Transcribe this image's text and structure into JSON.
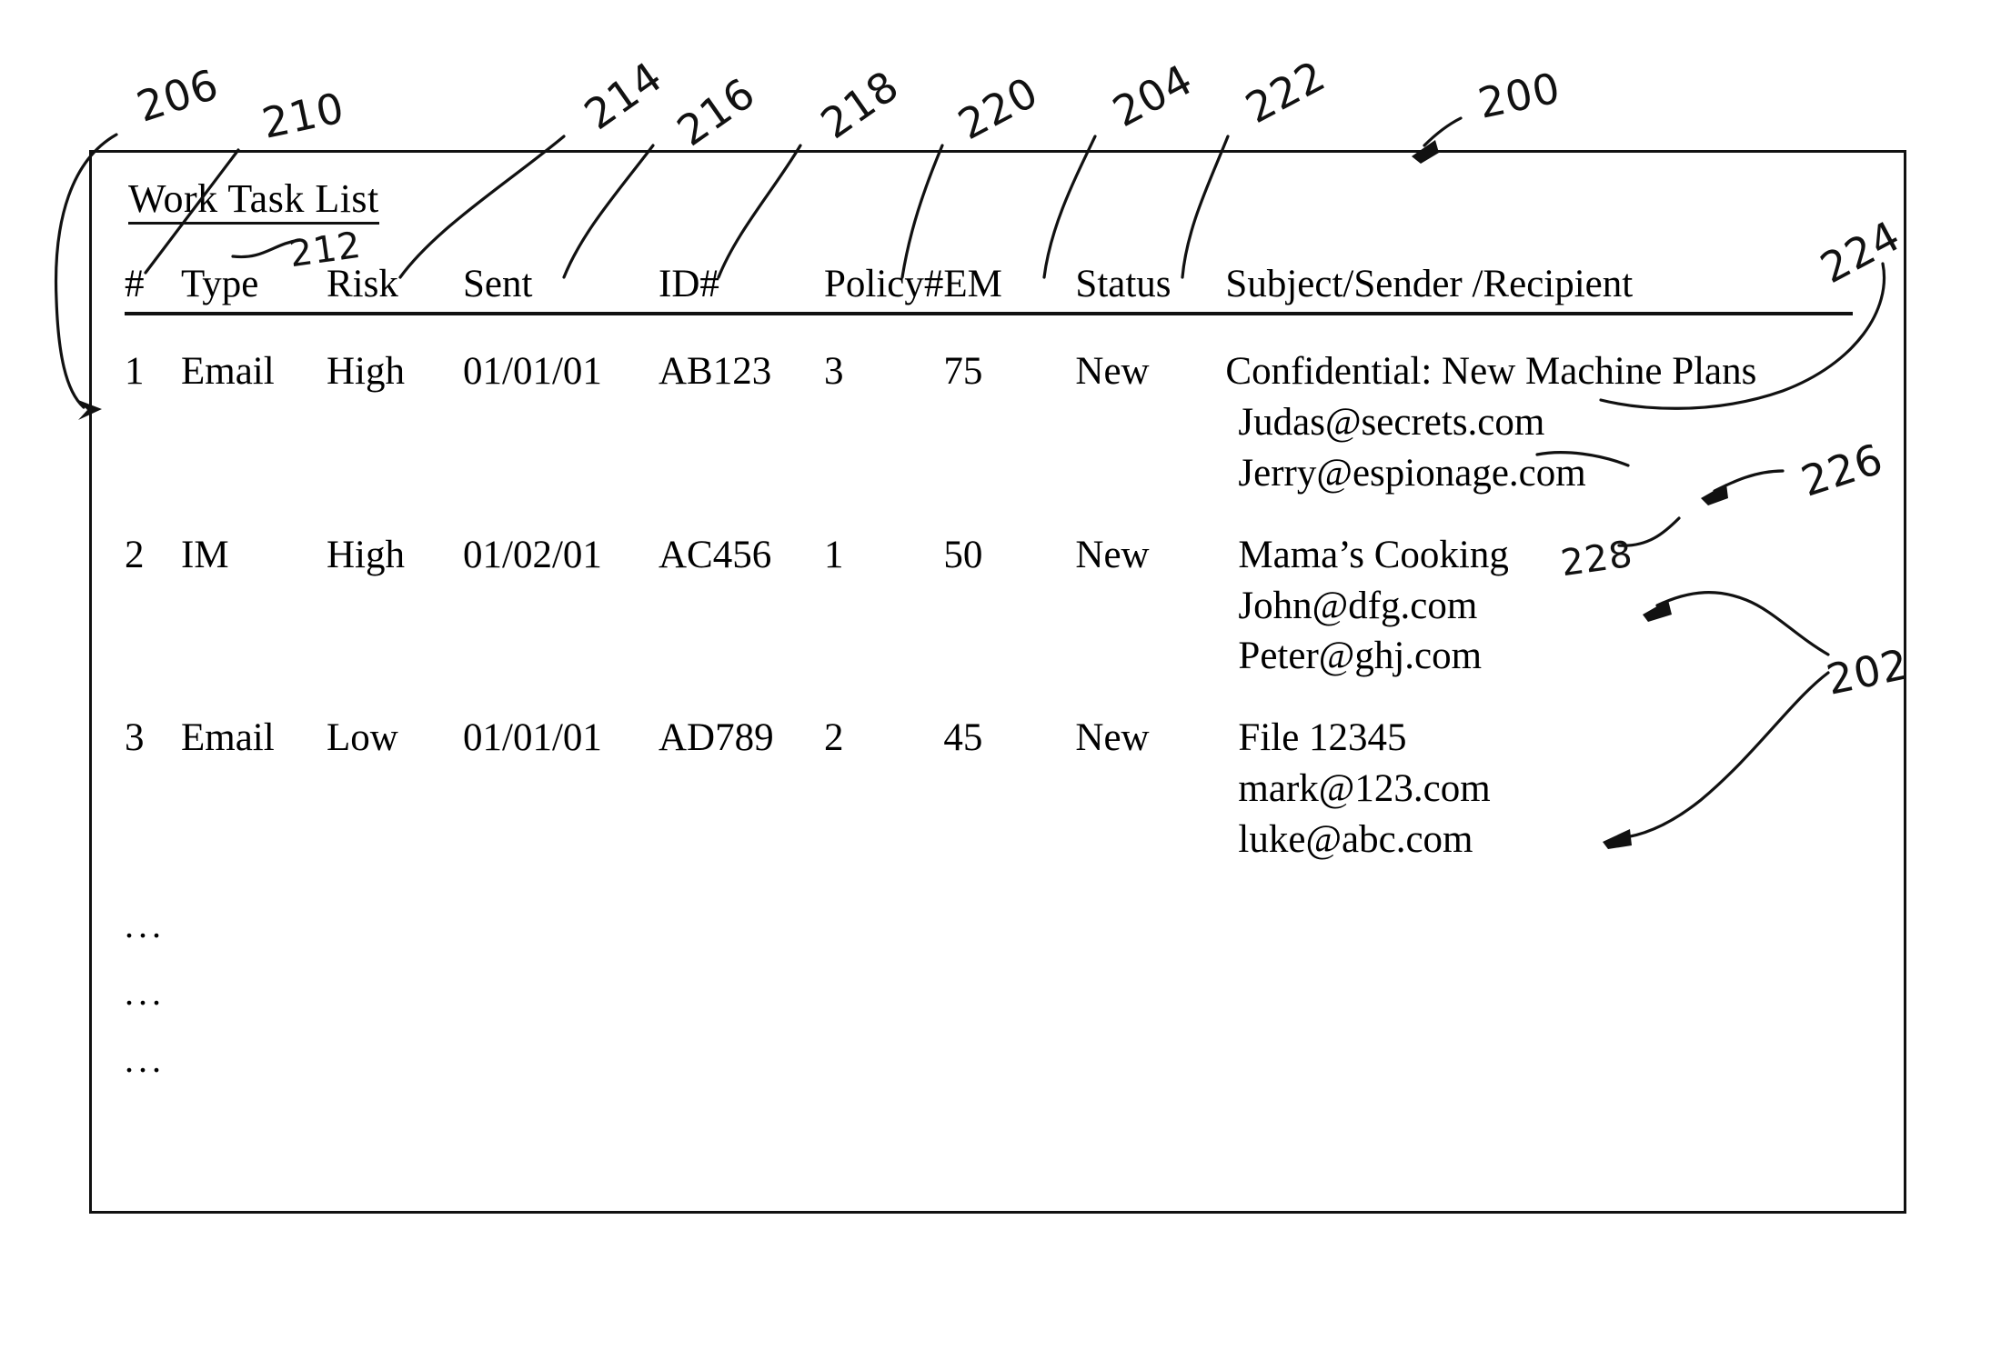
{
  "figure": {
    "title": "Work Task List",
    "title_ref": "212",
    "figure_ref": "200"
  },
  "table": {
    "headers": [
      {
        "key": "num",
        "label": "#"
      },
      {
        "key": "type",
        "label": "Type"
      },
      {
        "key": "risk",
        "label": "Risk"
      },
      {
        "key": "sent",
        "label": "Sent"
      },
      {
        "key": "id",
        "label": "ID#"
      },
      {
        "key": "policy",
        "label": "Policy#"
      },
      {
        "key": "em",
        "label": "EM"
      },
      {
        "key": "status",
        "label": "Status"
      },
      {
        "key": "subject",
        "label": "Subject/Sender /Recipient"
      }
    ],
    "rows": [
      {
        "num": "1",
        "type": "Email",
        "risk": "High",
        "sent": "01/01/01",
        "id": "AB123",
        "policy": "3",
        "em": "75",
        "status": "New",
        "subject": "Confidential: New Machine Plans",
        "sender": "Judas@secrets.com",
        "recipient": "Jerry@espionage.com"
      },
      {
        "num": "2",
        "type": "IM",
        "risk": "High",
        "sent": "01/02/01",
        "id": "AC456",
        "policy": "1",
        "em": "50",
        "status": "New",
        "subject": "Mama’s Cooking",
        "sender": "John@dfg.com",
        "recipient": "Peter@ghj.com"
      },
      {
        "num": "3",
        "type": "Email",
        "risk": "Low",
        "sent": "01/01/01",
        "id": "AD789",
        "policy": "2",
        "em": "45",
        "status": "New",
        "subject": "File 12345",
        "sender": "mark@123.com",
        "recipient": "luke@abc.com"
      }
    ],
    "continuation_rows": [
      {
        "mark": "..."
      },
      {
        "mark": "..."
      },
      {
        "mark": "..."
      }
    ]
  },
  "reference_numerals": {
    "r206": "206",
    "r210": "210",
    "r212": "212",
    "r214": "214",
    "r216": "216",
    "r218": "218",
    "r220": "220",
    "r204": "204",
    "r222": "222",
    "r200": "200",
    "r224": "224",
    "r226": "226",
    "r228": "228",
    "r202": "202"
  }
}
